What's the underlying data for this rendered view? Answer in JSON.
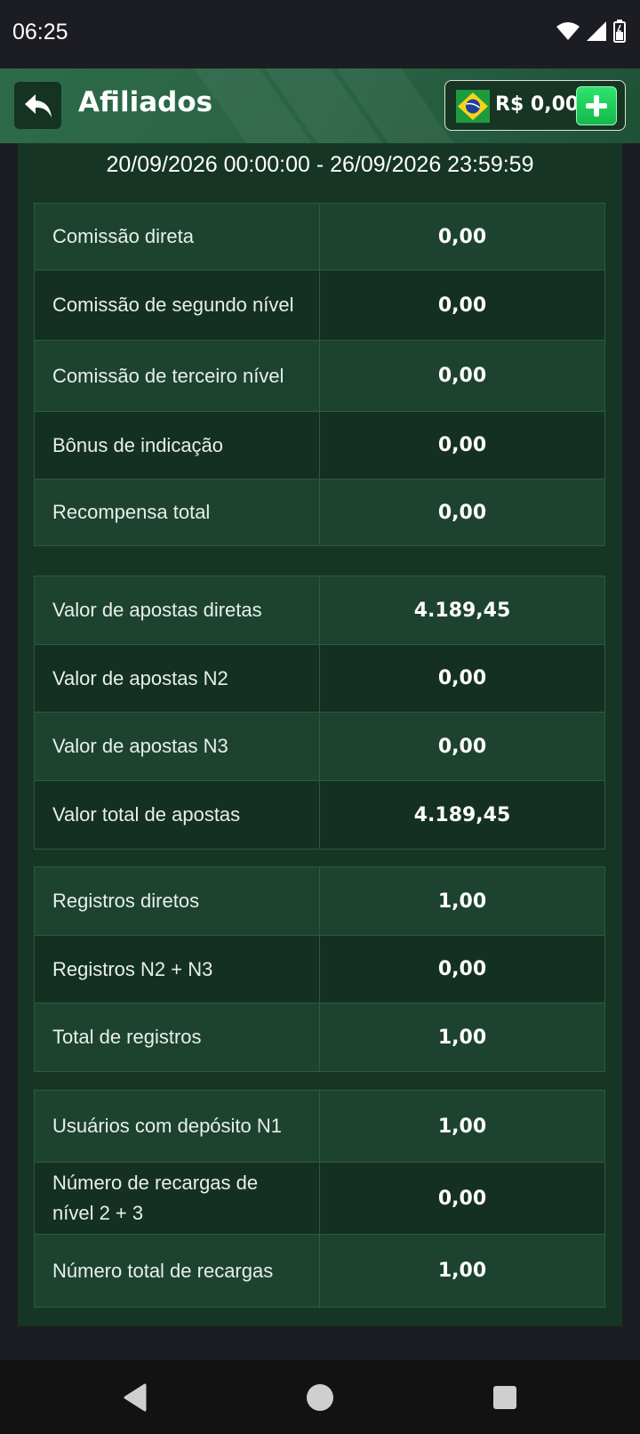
{
  "status": {
    "time": "06:25"
  },
  "header": {
    "title": "Afiliados",
    "balance": "R$ 0,00"
  },
  "date_range": "20/09/2026 00:00:00 - 26/09/2026 23:59:59",
  "groups": [
    {
      "rows": [
        {
          "label": "Comissão direta",
          "value": "0,00"
        },
        {
          "label": "Comissão de segundo nível",
          "value": "0,00"
        },
        {
          "label": "Comissão de terceiro nível",
          "value": "0,00"
        },
        {
          "label": "Bônus de indicação",
          "value": "0,00"
        },
        {
          "label": "Recompensa total",
          "value": "0,00"
        }
      ]
    },
    {
      "rows": [
        {
          "label": "Valor de apostas diretas",
          "value": "4.189,45"
        },
        {
          "label": "Valor de apostas N2",
          "value": "0,00"
        },
        {
          "label": "Valor de apostas N3",
          "value": "0,00"
        },
        {
          "label": "Valor total de apostas",
          "value": "4.189,45"
        }
      ]
    },
    {
      "rows": [
        {
          "label": "Registros diretos",
          "value": "1,00"
        },
        {
          "label": "Registros N2 + N3",
          "value": "0,00"
        },
        {
          "label": "Total de registros",
          "value": "1,00"
        }
      ]
    },
    {
      "rows": [
        {
          "label": "Usuários com depósito N1",
          "value": "1,00"
        },
        {
          "label": "Número de recargas de nível 2 + 3",
          "value": "0,00"
        },
        {
          "label": "Número total de recargas",
          "value": "1,00"
        }
      ]
    }
  ],
  "colors": {
    "accent": "#1fc85a",
    "panel": "#173525",
    "row_light": "#1d4330",
    "row_dark": "#143022"
  }
}
